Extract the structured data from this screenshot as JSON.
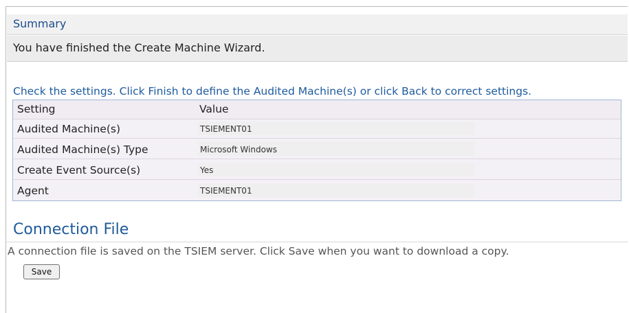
{
  "summary": {
    "title": "Summary",
    "finished_message": "You have finished the Create Machine Wizard."
  },
  "settings": {
    "instruction": "Check the settings. Click Finish to define the Audited Machine(s) or click Back to correct settings.",
    "columns": [
      "Setting",
      "Value"
    ],
    "rows": [
      {
        "setting": "Audited Machine(s)",
        "value": "TSIEMENT01"
      },
      {
        "setting": "Audited Machine(s) Type",
        "value": "Microsoft Windows"
      },
      {
        "setting": "Create Event Source(s)",
        "value": "Yes"
      },
      {
        "setting": "Agent",
        "value": "TSIEMENT01"
      }
    ]
  },
  "connection": {
    "title": "Connection File",
    "description": "A connection file is saved on the TSIEM server. Click Save when you want to download a copy.",
    "save_label": "Save"
  },
  "colors": {
    "accent": "#1f5a99",
    "table_border": "#9fb6d1"
  }
}
